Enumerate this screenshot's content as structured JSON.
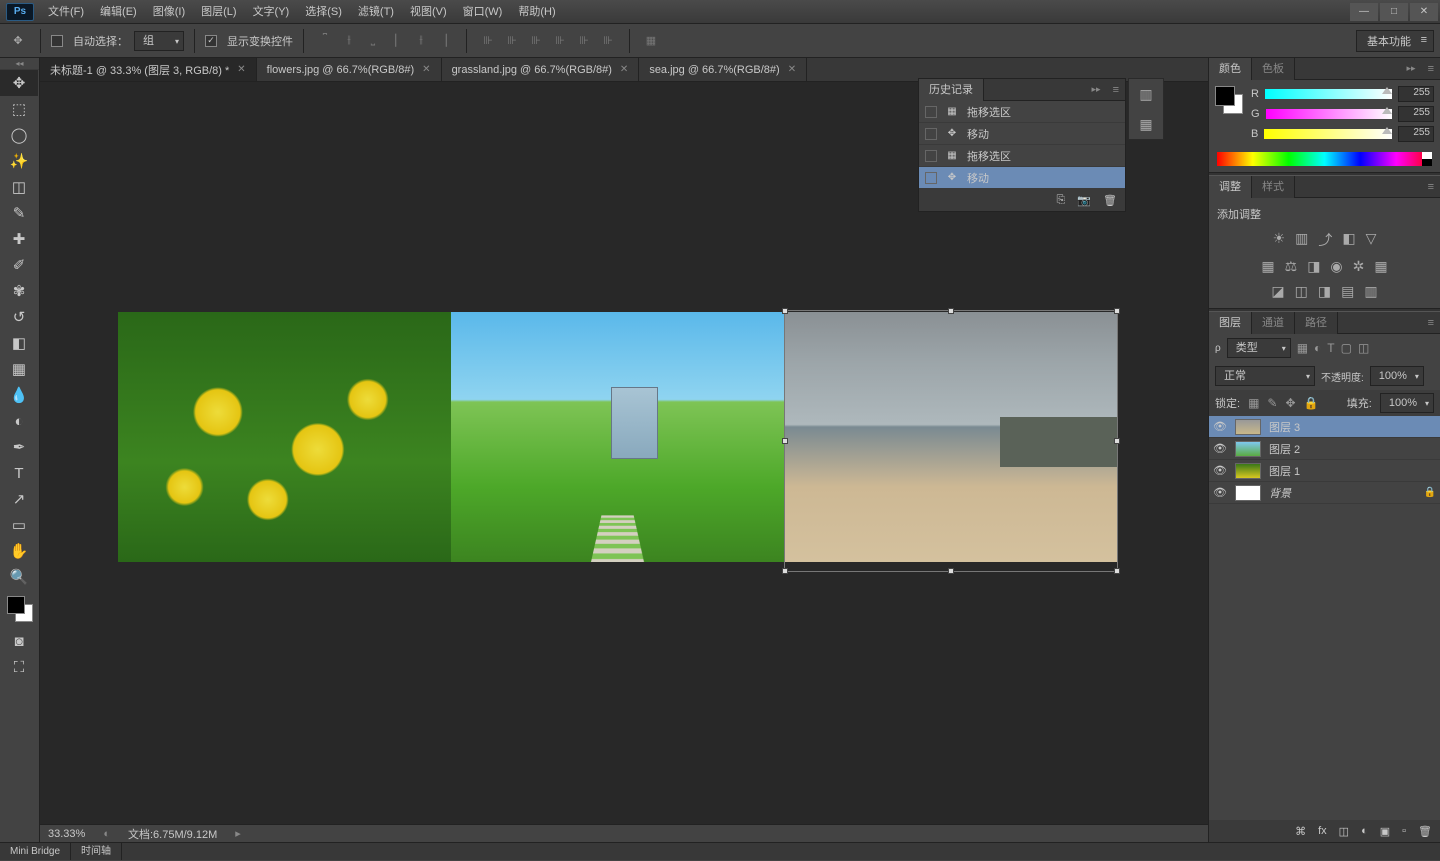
{
  "menubar": [
    "文件(F)",
    "编辑(E)",
    "图像(I)",
    "图层(L)",
    "文字(Y)",
    "选择(S)",
    "滤镜(T)",
    "视图(V)",
    "窗口(W)",
    "帮助(H)"
  ],
  "optionsbar": {
    "auto_select_label": "自动选择：",
    "auto_select_checked": false,
    "select_mode": "组",
    "show_transform_label": "显示变换控件",
    "show_transform_checked": true,
    "workspace": "基本功能"
  },
  "tabs": [
    {
      "title": "未标题-1 @ 33.3% (图层 3, RGB/8) *",
      "active": true
    },
    {
      "title": "flowers.jpg @ 66.7%(RGB/8#)",
      "active": false
    },
    {
      "title": "grassland.jpg @ 66.7%(RGB/8#)",
      "active": false
    },
    {
      "title": "sea.jpg @ 66.7%(RGB/8#)",
      "active": false
    }
  ],
  "history": {
    "title": "历史记录",
    "items": [
      {
        "icon": "▦",
        "label": "拖移选区",
        "sel": false
      },
      {
        "icon": "✥",
        "label": "移动",
        "sel": false
      },
      {
        "icon": "▦",
        "label": "拖移选区",
        "sel": false
      },
      {
        "icon": "✥",
        "label": "移动",
        "sel": true
      }
    ]
  },
  "color": {
    "tab_color": "颜色",
    "tab_swatches": "色板",
    "r": {
      "label": "R",
      "value": "255"
    },
    "g": {
      "label": "G",
      "value": "255"
    },
    "b": {
      "label": "B",
      "value": "255"
    }
  },
  "adjustments": {
    "tab_adj": "调整",
    "tab_styles": "样式",
    "add_label": "添加调整"
  },
  "layers": {
    "tab_layers": "图层",
    "tab_channels": "通道",
    "tab_paths": "路径",
    "filter_label": "类型",
    "blend_mode": "正常",
    "opacity_label": "不透明度:",
    "opacity": "100%",
    "lock_label": "锁定:",
    "fill_label": "填充:",
    "fill": "100%",
    "items": [
      {
        "name": "图层 3",
        "thumb": "lt1",
        "sel": true,
        "locked": false,
        "italic": false
      },
      {
        "name": "图层 2",
        "thumb": "lt2",
        "sel": false,
        "locked": false,
        "italic": false
      },
      {
        "name": "图层 1",
        "thumb": "lt3",
        "sel": false,
        "locked": false,
        "italic": false
      },
      {
        "name": "背景",
        "thumb": "lt-bg",
        "sel": false,
        "locked": true,
        "italic": true
      }
    ]
  },
  "statusbar": {
    "zoom": "33.33%",
    "doc_label": "文档:",
    "doc_size": "6.75M/9.12M"
  },
  "bottom_tabs": [
    "Mini Bridge",
    "时间轴"
  ],
  "tools": [
    "↖",
    "⬚",
    "◯",
    "✨",
    "⬚",
    "✎",
    "✐",
    "⊕",
    "◌",
    "✎",
    "⊡",
    "◧",
    "△",
    "◐",
    "◒",
    "✒",
    "T",
    "↗",
    "▭",
    "✋",
    "🔍"
  ]
}
